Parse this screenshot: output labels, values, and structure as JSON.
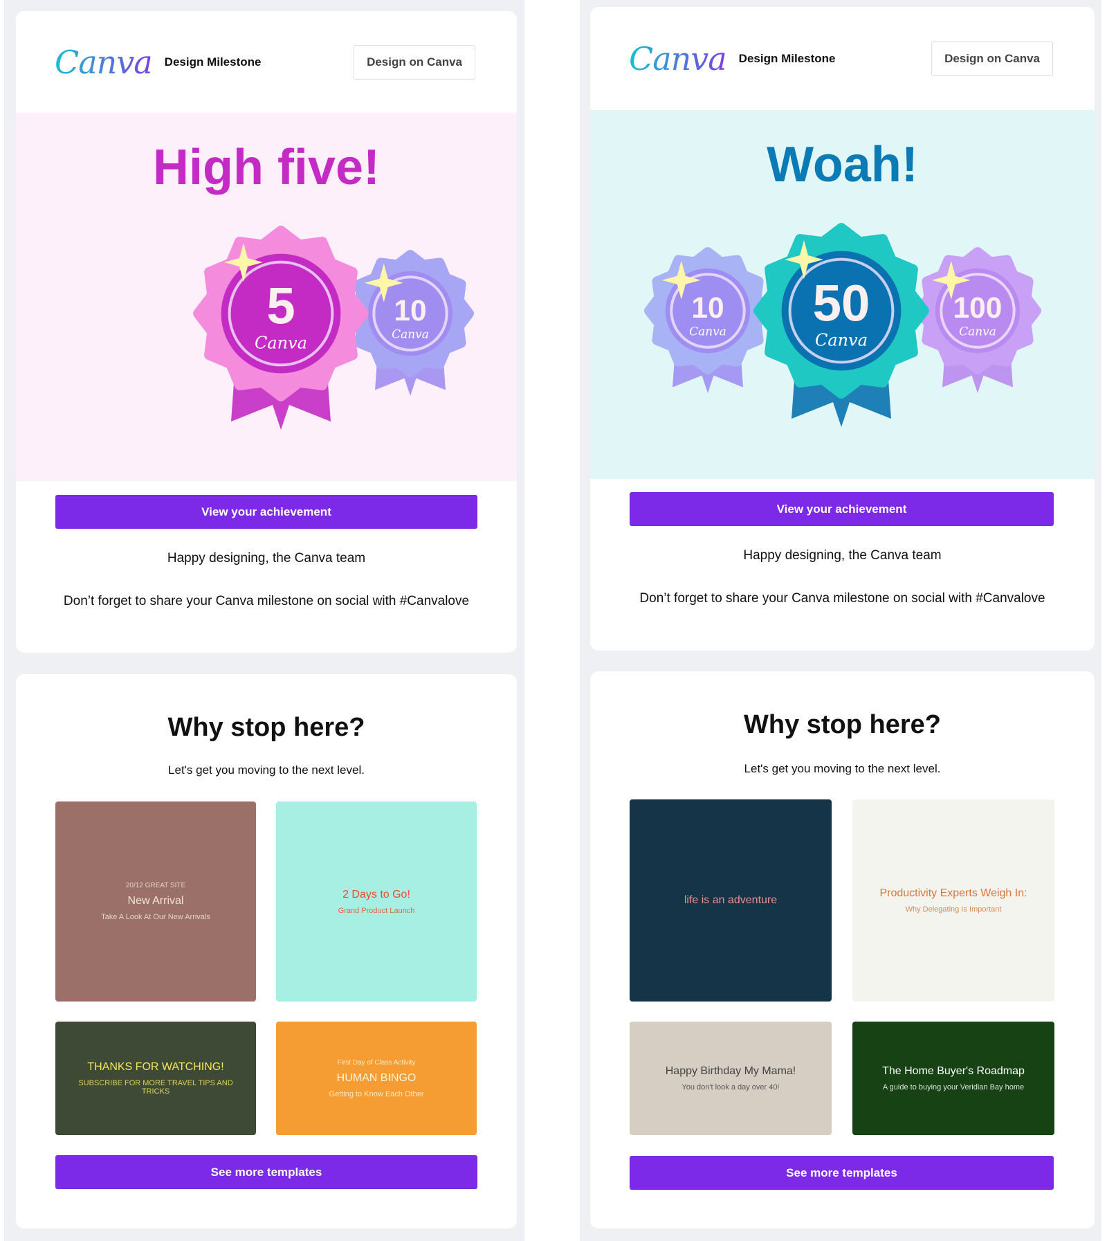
{
  "emails": [
    {
      "logo": "Canva",
      "header_title": "Design Milestone",
      "header_button": "Design on Canva",
      "hero_title": "High five!",
      "hero_color": "#c42bc4",
      "hero_bg": "#fdf0fb",
      "badges": [
        {
          "number": "5",
          "label": "Canva",
          "color": "#c42bc4",
          "petal": "#f48bdc"
        },
        {
          "number": "10",
          "label": "Canva",
          "color": "#a18df0",
          "petal": "#a7a6f5"
        }
      ],
      "cta": "View your achievement",
      "signoff": "Happy designing, the Canva team",
      "share": "Don’t forget to share your Canva milestone on social with #Canvalove",
      "why_title": "Why stop here?",
      "why_sub": "Let's get you moving to the next level.",
      "templates": [
        {
          "title": "New Arrival",
          "subtitle": "Take A Look At Our New Arrivals",
          "top": "20/12 GREAT SITE"
        },
        {
          "title": "2 Days to Go!",
          "subtitle": "Grand Product Launch"
        },
        {
          "title": "THANKS FOR WATCHING!",
          "subtitle": "SUBSCRIBE FOR MORE TRAVEL TIPS AND TRICKS"
        },
        {
          "title": "HUMAN BINGO",
          "subtitle": "Getting to Know Each Other",
          "top": "First Day of Class Activity"
        }
      ],
      "more": "See more templates"
    },
    {
      "logo": "Canva",
      "header_title": "Design Milestone",
      "header_button": "Design on Canva",
      "hero_title": "Woah!",
      "hero_color": "#0b7bb5",
      "hero_bg": "#e1f7f7",
      "badges": [
        {
          "number": "10",
          "label": "Canva",
          "color": "#9f8ef2",
          "petal": "#a7b3f5"
        },
        {
          "number": "50",
          "label": "Canva",
          "color": "#0a72b0",
          "petal": "#1fc8c2"
        },
        {
          "number": "100",
          "label": "Canva",
          "color": "#b98af0",
          "petal": "#c8a0f5"
        }
      ],
      "cta": "View your achievement",
      "signoff": "Happy designing, the Canva team",
      "share": "Don’t forget to share your Canva milestone on social with #Canvalove",
      "why_title": "Why stop here?",
      "why_sub": "Let's get you moving to the next level.",
      "templates": [
        {
          "title": "life is an adventure"
        },
        {
          "title": "Productivity Experts Weigh In:",
          "subtitle": "Why Delegating Is Important"
        },
        {
          "title": "Happy Birthday My Mama!",
          "subtitle": "You don't look a day over 40!"
        },
        {
          "title": "The Home Buyer's Roadmap",
          "subtitle": "A guide to buying your Veridian Bay home"
        }
      ],
      "more": "See more templates"
    }
  ]
}
